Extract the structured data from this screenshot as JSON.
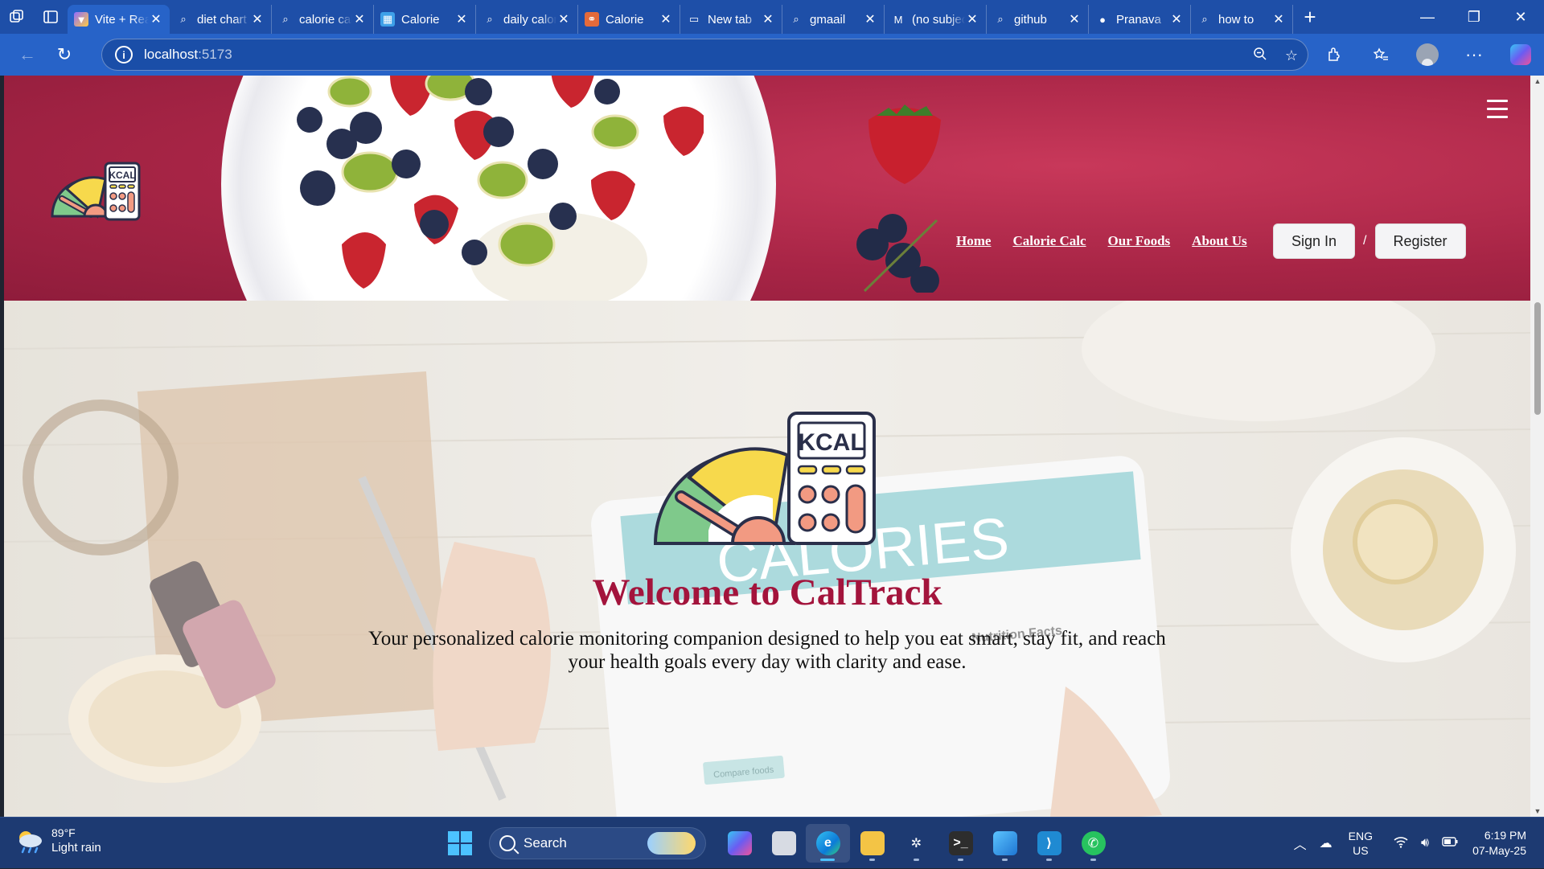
{
  "browser": {
    "tabs": [
      {
        "title": "Vite + React",
        "icon": "vite-icon",
        "active": true
      },
      {
        "title": "diet chart",
        "icon": "search-icon",
        "active": false
      },
      {
        "title": "calorie calculator",
        "icon": "search-icon",
        "active": false
      },
      {
        "title": "Calorie",
        "icon": "calculator-icon",
        "active": false
      },
      {
        "title": "daily calories",
        "icon": "search-icon",
        "active": false
      },
      {
        "title": "Calorie",
        "icon": "link-icon",
        "active": false
      },
      {
        "title": "New tab",
        "icon": "newtab-icon",
        "active": false
      },
      {
        "title": "gmaail",
        "icon": "search-icon",
        "active": false
      },
      {
        "title": "(no subject)",
        "icon": "gmail-icon",
        "active": false
      },
      {
        "title": "github",
        "icon": "search-icon",
        "active": false
      },
      {
        "title": "Pranava",
        "icon": "github-icon",
        "active": false
      },
      {
        "title": "how to",
        "icon": "search-icon",
        "active": false
      }
    ],
    "address": {
      "host": "localhost",
      "port": ":5173"
    }
  },
  "site": {
    "nav": {
      "home": "Home",
      "calorie_calc": "Calorie Calc",
      "our_foods": "Our Foods",
      "about_us": "About Us"
    },
    "auth": {
      "sign_in": "Sign In",
      "separator": "/",
      "register": "Register"
    },
    "logo_text": "KCAL",
    "hero": {
      "logo_text": "KCAL",
      "title": "Welcome to CalTrack",
      "description": "Your personalized calorie monitoring companion designed to help you eat smart, stay fit, and reach your health goals every day with clarity and ease.",
      "tablet_heading": "CALORIES",
      "tablet_panel": "Nutrition Facts",
      "tablet_button": "Compare foods"
    },
    "colors": {
      "header_bg": "#a82546",
      "title_color": "#a3143c"
    }
  },
  "taskbar": {
    "weather": {
      "temp": "89°F",
      "condition": "Light rain"
    },
    "search_label": "Search",
    "apps": [
      "copilot-icon",
      "task-view-icon",
      "edge-icon",
      "file-explorer-icon",
      "chatgpt-icon",
      "terminal-icon",
      "photos-icon",
      "vscode-icon",
      "whatsapp-icon"
    ],
    "language": {
      "line1": "ENG",
      "line2": "US"
    },
    "clock": {
      "time": "6:19 PM",
      "date": "07-May-25"
    }
  }
}
